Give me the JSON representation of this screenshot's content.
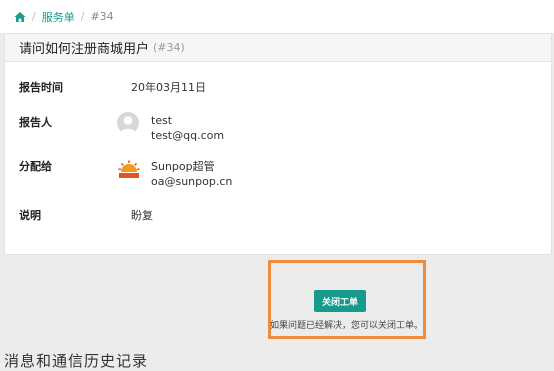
{
  "breadcrumb": {
    "home_icon": "home-icon",
    "sep1": "/",
    "section": "服务单",
    "sep2": "/",
    "current": "#34"
  },
  "ticket": {
    "title": "请问如何注册商城用户",
    "id_display": "(#34)",
    "fields": {
      "report_time_label": "报告时间",
      "report_time_value": "20年03月11日",
      "reporter_label": "报告人",
      "reporter_name": "test",
      "reporter_email": "test@qq.com",
      "assignee_label": "分配给",
      "assignee_name": "Sunpop超管",
      "assignee_email": "oa@sunpop.cn",
      "description_label": "说明",
      "description_value": "盼复"
    }
  },
  "actions": {
    "close_button": "关闭工单",
    "hint": "如果问题已经解决，您可以关闭工单。",
    "highlight_color": "#f08a3c"
  },
  "history_heading": "消息和通信历史记录",
  "colors": {
    "accent": "#169a8d",
    "link": "#1a9b8f"
  }
}
